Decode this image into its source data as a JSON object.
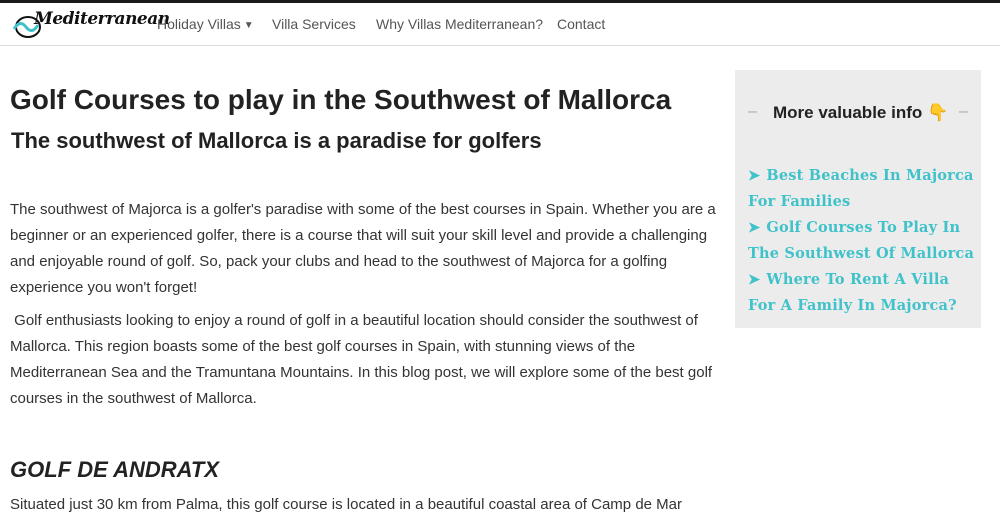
{
  "brand": {
    "name": "Mediterranean"
  },
  "nav": {
    "items": [
      {
        "label": "Holiday Villas",
        "has_dropdown": true
      },
      {
        "label": "Villa Services",
        "has_dropdown": false
      },
      {
        "label": "Why Villas Mediterranean?",
        "has_dropdown": false
      },
      {
        "label": "Contact",
        "has_dropdown": false
      }
    ]
  },
  "article": {
    "title": "Golf Courses to play in the Southwest of Mallorca",
    "subtitle": "The southwest of Mallorca is a paradise for golfers",
    "paragraphs": [
      "The southwest of Majorca is a golfer's paradise with some of the best courses in Spain. Whether you are a beginner or an experienced golfer, there is a course that will suit your skill level and provide a challenging and enjoyable round of golf. So, pack your clubs and head to the southwest of Majorca for a golfing experience you won't forget!",
      " Golf enthusiasts looking to enjoy a round of golf in a beautiful location should consider the southwest of Mallorca. This region boasts some of the best golf courses in Spain, with stunning views of the Mediterranean Sea and the Tramuntana Mountains. In this blog post, we will explore some of the best golf courses in the southwest of Mallorca."
    ],
    "section_heading": "GOLF DE ANDRATX",
    "section_text": "Situated just 30 km from Palma, this golf course is located in a beautiful coastal area of Camp de Mar"
  },
  "sidebar": {
    "title": "More valuable info 👇",
    "links": [
      "Best Beaches In Majorca For Families",
      "Golf Courses To Play In The Southwest Of Mallorca",
      "Where To Rent A Villa For A Family In Majorca?"
    ],
    "link_color": "#3fc2c9",
    "background": "#ececec"
  },
  "icons": {
    "bullet": "arrow-right-icon",
    "logo": "wave-m-logo",
    "caret": "caret-down-icon"
  }
}
